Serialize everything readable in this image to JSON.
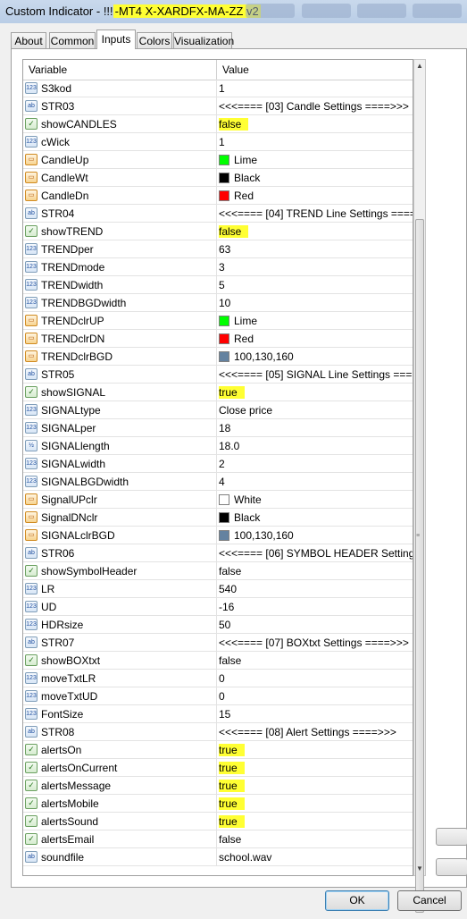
{
  "window": {
    "title_prefix": "Custom Indicator - !!!",
    "title_highlight": "-MT4 X-XARDFX-MA-ZZ v2"
  },
  "tabs": [
    {
      "label": "About"
    },
    {
      "label": "Common"
    },
    {
      "label": "Inputs",
      "active": true
    },
    {
      "label": "Colors"
    },
    {
      "label": "Visualization"
    }
  ],
  "table": {
    "headers": {
      "variable": "Variable",
      "value": "Value"
    },
    "rows": [
      {
        "type": "int",
        "name": "S3kod",
        "value": "1"
      },
      {
        "type": "string",
        "name": "STR03",
        "value": "<<<==== [03] Candle Settings ====>>>"
      },
      {
        "type": "bool",
        "name": "showCANDLES",
        "value": "false",
        "highlight": true
      },
      {
        "type": "int",
        "name": "cWick",
        "value": "1"
      },
      {
        "type": "color",
        "name": "CandleUp",
        "value": "Lime",
        "swatch": "#00ff00"
      },
      {
        "type": "color",
        "name": "CandleWt",
        "value": "Black",
        "swatch": "#000000"
      },
      {
        "type": "color",
        "name": "CandleDn",
        "value": "Red",
        "swatch": "#ff0000"
      },
      {
        "type": "string",
        "name": "STR04",
        "value": "<<<==== [04] TREND Line Settings ====..."
      },
      {
        "type": "bool",
        "name": "showTREND",
        "value": "false",
        "highlight": true
      },
      {
        "type": "int",
        "name": "TRENDper",
        "value": "63"
      },
      {
        "type": "int",
        "name": "TRENDmode",
        "value": "3"
      },
      {
        "type": "int",
        "name": "TRENDwidth",
        "value": "5"
      },
      {
        "type": "int",
        "name": "TRENDBGDwidth",
        "value": "10"
      },
      {
        "type": "color",
        "name": "TRENDclrUP",
        "value": "Lime",
        "swatch": "#00ff00"
      },
      {
        "type": "color",
        "name": "TRENDclrDN",
        "value": "Red",
        "swatch": "#ff0000"
      },
      {
        "type": "color",
        "name": "TRENDclrBGD",
        "value": "100,130,160",
        "swatch": "#6482a0"
      },
      {
        "type": "string",
        "name": "STR05",
        "value": "<<<==== [05] SIGNAL Line Settings ====..."
      },
      {
        "type": "bool",
        "name": "showSIGNAL",
        "value": "true",
        "highlight": true
      },
      {
        "type": "int",
        "name": "SIGNALtype",
        "value": "Close price"
      },
      {
        "type": "int",
        "name": "SIGNALper",
        "value": "18"
      },
      {
        "type": "double",
        "name": "SIGNALlength",
        "value": "18.0"
      },
      {
        "type": "int",
        "name": "SIGNALwidth",
        "value": "2"
      },
      {
        "type": "int",
        "name": "SIGNALBGDwidth",
        "value": "4"
      },
      {
        "type": "color",
        "name": "SignalUPclr",
        "value": "White",
        "swatch": "#ffffff"
      },
      {
        "type": "color",
        "name": "SignalDNclr",
        "value": "Black",
        "swatch": "#000000"
      },
      {
        "type": "color",
        "name": "SIGNALclrBGD",
        "value": "100,130,160",
        "swatch": "#6482a0"
      },
      {
        "type": "string",
        "name": "STR06",
        "value": "<<<==== [06] SYMBOL HEADER Settings ..."
      },
      {
        "type": "bool",
        "name": "showSymbolHeader",
        "value": "false"
      },
      {
        "type": "int",
        "name": "LR",
        "value": "540"
      },
      {
        "type": "int",
        "name": "UD",
        "value": "-16"
      },
      {
        "type": "int",
        "name": "HDRsize",
        "value": "50"
      },
      {
        "type": "string",
        "name": "STR07",
        "value": "<<<==== [07] BOXtxt Settings ====>>>"
      },
      {
        "type": "bool",
        "name": "showBOXtxt",
        "value": "false"
      },
      {
        "type": "int",
        "name": "moveTxtLR",
        "value": "0"
      },
      {
        "type": "int",
        "name": "moveTxtUD",
        "value": "0"
      },
      {
        "type": "int",
        "name": "FontSize",
        "value": "15"
      },
      {
        "type": "string",
        "name": "STR08",
        "value": "<<<==== [08] Alert Settings ====>>>"
      },
      {
        "type": "bool",
        "name": "alertsOn",
        "value": "true",
        "highlight": true
      },
      {
        "type": "bool",
        "name": "alertsOnCurrent",
        "value": "true",
        "highlight": true
      },
      {
        "type": "bool",
        "name": "alertsMessage",
        "value": "true",
        "highlight": true
      },
      {
        "type": "bool",
        "name": "alertsMobile",
        "value": "true",
        "highlight": true
      },
      {
        "type": "bool",
        "name": "alertsSound",
        "value": "true",
        "highlight": true
      },
      {
        "type": "bool",
        "name": "alertsEmail",
        "value": "false"
      },
      {
        "type": "string",
        "name": "soundfile",
        "value": "school.wav"
      }
    ]
  },
  "icons": {
    "int": "123",
    "double": "½",
    "string": "ab",
    "bool": "✓",
    "color": "▭"
  },
  "buttons": {
    "ok": "OK",
    "cancel": "Cancel"
  }
}
